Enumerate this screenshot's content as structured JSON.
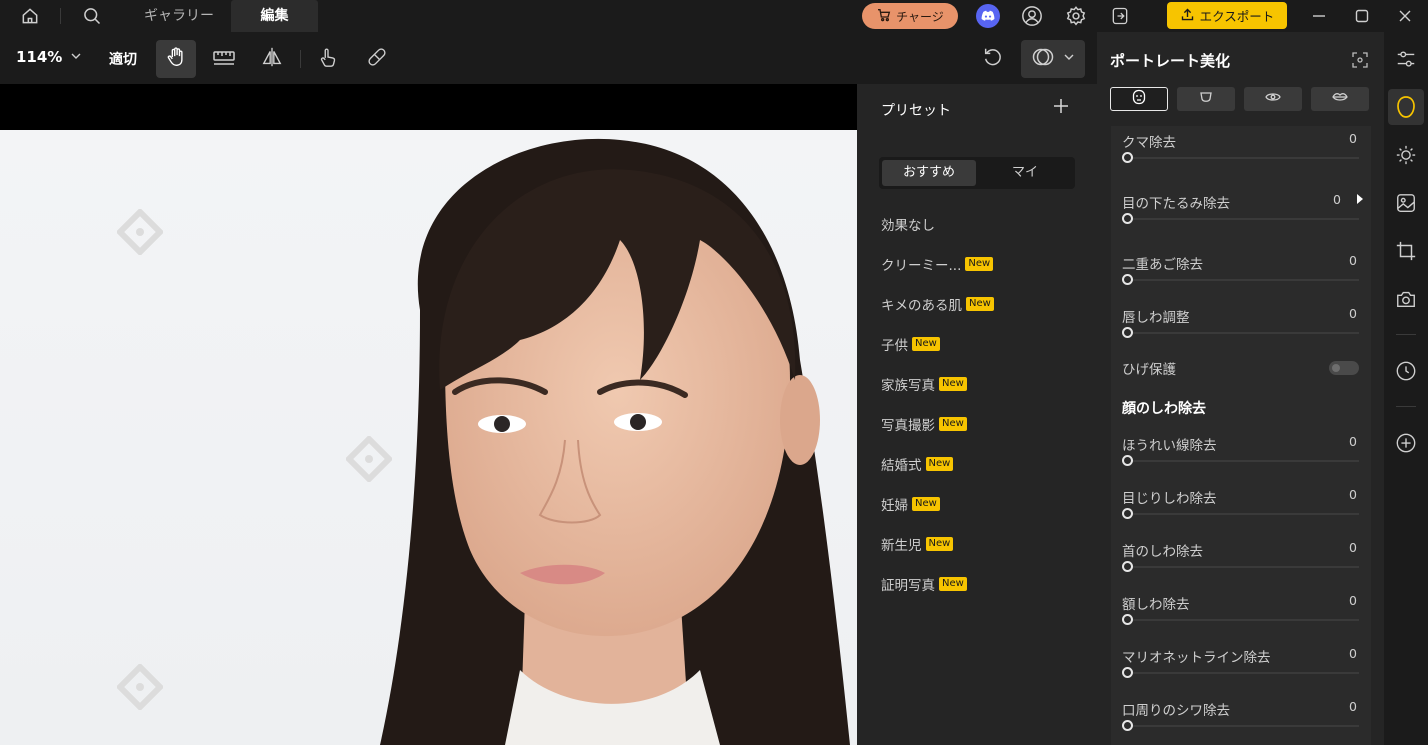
{
  "titlebar": {
    "tabs": [
      "ギャラリー",
      "編集"
    ],
    "charge_label": "チャージ",
    "export_label": "エクスポート"
  },
  "toolbar": {
    "zoom": "114%",
    "fit_label": "適切"
  },
  "presets": {
    "title": "プリセット",
    "segments": [
      "おすすめ",
      "マイ"
    ],
    "items": [
      {
        "label": "効果なし",
        "badge": ""
      },
      {
        "label": "クリーミー...",
        "badge": "New"
      },
      {
        "label": "キメのある肌",
        "badge": "New"
      },
      {
        "label": "子供",
        "badge": "New"
      },
      {
        "label": "家族写真",
        "badge": "New"
      },
      {
        "label": "写真撮影",
        "badge": "New"
      },
      {
        "label": "結婚式",
        "badge": "New"
      },
      {
        "label": "妊婦",
        "badge": "New"
      },
      {
        "label": "新生児",
        "badge": "New"
      },
      {
        "label": "証明写真",
        "badge": "New"
      }
    ]
  },
  "adjust": {
    "title": "ポートレート美化",
    "sliders_top": [
      {
        "label": "クマ除去",
        "value": "0"
      },
      {
        "label": "目の下たるみ除去",
        "value": "0"
      },
      {
        "label": "二重あご除去",
        "value": "0"
      },
      {
        "label": "唇しわ調整",
        "value": "0"
      }
    ],
    "toggle_label": "ひげ保護",
    "section_title": "顔のしわ除去",
    "sliders_bottom": [
      {
        "label": "ほうれい線除去",
        "value": "0"
      },
      {
        "label": "目じりしわ除去",
        "value": "0"
      },
      {
        "label": "首のしわ除去",
        "value": "0"
      },
      {
        "label": "額しわ除去",
        "value": "0"
      },
      {
        "label": "マリオネットライン除去",
        "value": "0"
      },
      {
        "label": "口周りのシワ除去",
        "value": "0"
      }
    ]
  },
  "colors": {
    "accent": "#f7c400",
    "charge": "#e8936a",
    "discord": "#5865f2",
    "panel": "#252525",
    "background": "#1b1b1b"
  },
  "icons": [
    "home-icon",
    "search-icon",
    "cart-icon",
    "discord-icon",
    "account-icon",
    "settings-icon",
    "login-icon",
    "upload-icon",
    "minimize-icon",
    "maximize-icon",
    "close-icon",
    "hand-icon",
    "ruler-icon",
    "flip-icon",
    "touch-icon",
    "bandage-icon",
    "undo-icon",
    "compare-icon",
    "chevron-down-icon",
    "plus-icon",
    "fullscreen-icon",
    "face-icon",
    "sliders-icon",
    "portrait-icon",
    "sun-icon",
    "image-icon",
    "crop-icon",
    "camera-icon",
    "history-icon",
    "add-circle-icon"
  ]
}
